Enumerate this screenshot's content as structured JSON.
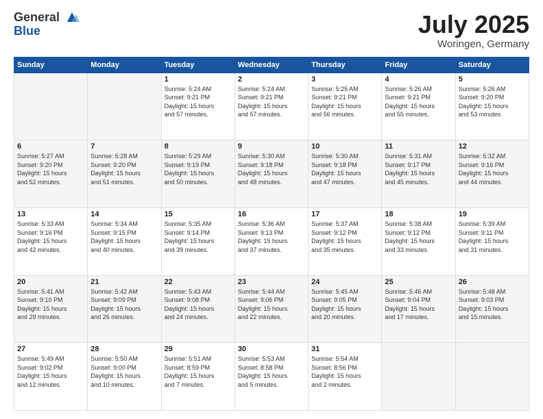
{
  "header": {
    "logo_general": "General",
    "logo_blue": "Blue",
    "month": "July 2025",
    "location": "Woringen, Germany"
  },
  "weekdays": [
    "Sunday",
    "Monday",
    "Tuesday",
    "Wednesday",
    "Thursday",
    "Friday",
    "Saturday"
  ],
  "weeks": [
    [
      {
        "day": "",
        "info": ""
      },
      {
        "day": "",
        "info": ""
      },
      {
        "day": "1",
        "info": "Sunrise: 5:24 AM\nSunset: 9:21 PM\nDaylight: 15 hours\nand 57 minutes."
      },
      {
        "day": "2",
        "info": "Sunrise: 5:24 AM\nSunset: 9:21 PM\nDaylight: 15 hours\nand 57 minutes."
      },
      {
        "day": "3",
        "info": "Sunrise: 5:25 AM\nSunset: 9:21 PM\nDaylight: 15 hours\nand 56 minutes."
      },
      {
        "day": "4",
        "info": "Sunrise: 5:26 AM\nSunset: 9:21 PM\nDaylight: 15 hours\nand 55 minutes."
      },
      {
        "day": "5",
        "info": "Sunrise: 5:26 AM\nSunset: 9:20 PM\nDaylight: 15 hours\nand 53 minutes."
      }
    ],
    [
      {
        "day": "6",
        "info": "Sunrise: 5:27 AM\nSunset: 9:20 PM\nDaylight: 15 hours\nand 52 minutes."
      },
      {
        "day": "7",
        "info": "Sunrise: 5:28 AM\nSunset: 9:20 PM\nDaylight: 15 hours\nand 51 minutes."
      },
      {
        "day": "8",
        "info": "Sunrise: 5:29 AM\nSunset: 9:19 PM\nDaylight: 15 hours\nand 50 minutes."
      },
      {
        "day": "9",
        "info": "Sunrise: 5:30 AM\nSunset: 9:18 PM\nDaylight: 15 hours\nand 48 minutes."
      },
      {
        "day": "10",
        "info": "Sunrise: 5:30 AM\nSunset: 9:18 PM\nDaylight: 15 hours\nand 47 minutes."
      },
      {
        "day": "11",
        "info": "Sunrise: 5:31 AM\nSunset: 9:17 PM\nDaylight: 15 hours\nand 45 minutes."
      },
      {
        "day": "12",
        "info": "Sunrise: 5:32 AM\nSunset: 9:16 PM\nDaylight: 15 hours\nand 44 minutes."
      }
    ],
    [
      {
        "day": "13",
        "info": "Sunrise: 5:33 AM\nSunset: 9:16 PM\nDaylight: 15 hours\nand 42 minutes."
      },
      {
        "day": "14",
        "info": "Sunrise: 5:34 AM\nSunset: 9:15 PM\nDaylight: 15 hours\nand 40 minutes."
      },
      {
        "day": "15",
        "info": "Sunrise: 5:35 AM\nSunset: 9:14 PM\nDaylight: 15 hours\nand 39 minutes."
      },
      {
        "day": "16",
        "info": "Sunrise: 5:36 AM\nSunset: 9:13 PM\nDaylight: 15 hours\nand 37 minutes."
      },
      {
        "day": "17",
        "info": "Sunrise: 5:37 AM\nSunset: 9:12 PM\nDaylight: 15 hours\nand 35 minutes."
      },
      {
        "day": "18",
        "info": "Sunrise: 5:38 AM\nSunset: 9:12 PM\nDaylight: 15 hours\nand 33 minutes."
      },
      {
        "day": "19",
        "info": "Sunrise: 5:39 AM\nSunset: 9:11 PM\nDaylight: 15 hours\nand 31 minutes."
      }
    ],
    [
      {
        "day": "20",
        "info": "Sunrise: 5:41 AM\nSunset: 9:10 PM\nDaylight: 15 hours\nand 29 minutes."
      },
      {
        "day": "21",
        "info": "Sunrise: 5:42 AM\nSunset: 9:09 PM\nDaylight: 15 hours\nand 26 minutes."
      },
      {
        "day": "22",
        "info": "Sunrise: 5:43 AM\nSunset: 9:08 PM\nDaylight: 15 hours\nand 24 minutes."
      },
      {
        "day": "23",
        "info": "Sunrise: 5:44 AM\nSunset: 9:06 PM\nDaylight: 15 hours\nand 22 minutes."
      },
      {
        "day": "24",
        "info": "Sunrise: 5:45 AM\nSunset: 9:05 PM\nDaylight: 15 hours\nand 20 minutes."
      },
      {
        "day": "25",
        "info": "Sunrise: 5:46 AM\nSunset: 9:04 PM\nDaylight: 15 hours\nand 17 minutes."
      },
      {
        "day": "26",
        "info": "Sunrise: 5:48 AM\nSunset: 9:03 PM\nDaylight: 15 hours\nand 15 minutes."
      }
    ],
    [
      {
        "day": "27",
        "info": "Sunrise: 5:49 AM\nSunset: 9:02 PM\nDaylight: 15 hours\nand 12 minutes."
      },
      {
        "day": "28",
        "info": "Sunrise: 5:50 AM\nSunset: 9:00 PM\nDaylight: 15 hours\nand 10 minutes."
      },
      {
        "day": "29",
        "info": "Sunrise: 5:51 AM\nSunset: 8:59 PM\nDaylight: 15 hours\nand 7 minutes."
      },
      {
        "day": "30",
        "info": "Sunrise: 5:53 AM\nSunset: 8:58 PM\nDaylight: 15 hours\nand 5 minutes."
      },
      {
        "day": "31",
        "info": "Sunrise: 5:54 AM\nSunset: 8:56 PM\nDaylight: 15 hours\nand 2 minutes."
      },
      {
        "day": "",
        "info": ""
      },
      {
        "day": "",
        "info": ""
      }
    ]
  ]
}
